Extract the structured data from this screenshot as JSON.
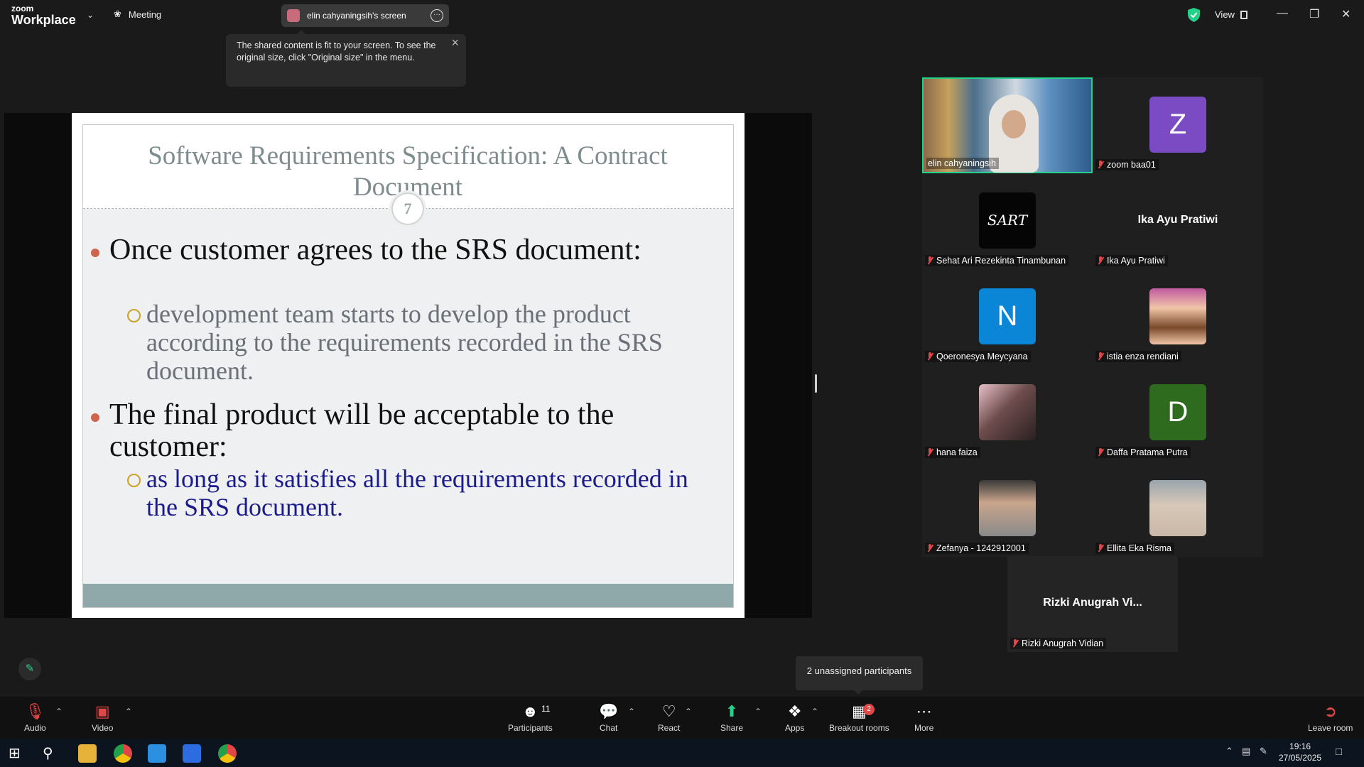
{
  "app": {
    "brand_top": "zoom",
    "brand_bottom": "Workplace",
    "meeting_label": "Meeting"
  },
  "share_pill": {
    "label": "elin cahyaningsih's screen"
  },
  "header": {
    "view_label": "View"
  },
  "tooltip": {
    "text": "The shared content is fit to your screen. To see the original size, click \"Original size\" in the menu."
  },
  "slide": {
    "title": "Software Requirements Specification: A Contract Document",
    "page_number": "7",
    "bullets": [
      {
        "text": "Once customer agrees to the SRS document:",
        "sub": "development team starts to develop the product according to the requirements recorded in the SRS document."
      },
      {
        "text": "The final product will be acceptable to the customer:",
        "sub": "as long as it satisfies all the requirements recorded in the SRS document."
      }
    ]
  },
  "participants": [
    {
      "name": "elin cahyaningsih",
      "type": "video",
      "active": true,
      "muted": false
    },
    {
      "name": "zoom baa01",
      "type": "initial",
      "initial": "Z",
      "color": "#7b4bc4",
      "muted": true
    },
    {
      "name": "Sehat Ari Rezekinta Tinambunan",
      "type": "logo",
      "initial": "SART",
      "color": "#050505",
      "muted": true
    },
    {
      "name": "Ika Ayu Pratiwi",
      "type": "text",
      "display": "Ika Ayu Pratiwi",
      "muted": true
    },
    {
      "name": "Qoeronesya Meycyana",
      "type": "initial",
      "initial": "N",
      "color": "#0b86d6",
      "muted": true
    },
    {
      "name": "istia enza rendiani",
      "type": "photo",
      "color": "#f1c5a8",
      "muted": true
    },
    {
      "name": "hana faiza",
      "type": "photo",
      "color": "#6d4c4c",
      "muted": true
    },
    {
      "name": "Daffa Pratama Putra",
      "type": "initial",
      "initial": "D",
      "color": "#2e6b1f",
      "muted": true
    },
    {
      "name": "Zefanya - 1242912001",
      "type": "photo",
      "color": "#8a8a8a",
      "muted": true
    },
    {
      "name": "Ellita Eka Risma",
      "type": "photo",
      "color": "#c9b8a8",
      "muted": true
    },
    {
      "name": "Rizki Anugrah Vidian",
      "type": "text",
      "display": "Rizki Anugrah Vi...",
      "muted": true
    }
  ],
  "unassigned": "2 unassigned participants",
  "toolbar": {
    "audio": "Audio",
    "video": "Video",
    "participants": "Participants",
    "participants_count": "11",
    "chat": "Chat",
    "react": "React",
    "share": "Share",
    "apps": "Apps",
    "breakout": "Breakout rooms",
    "breakout_badge": "2",
    "more": "More",
    "leave": "Leave room"
  },
  "taskbar": {
    "time": "19:16",
    "date": "27/05/2025"
  },
  "colors": {
    "accent": "#23d18b",
    "muted": "#e04848",
    "bullet": "#d0634c",
    "sub_bullet": "#c9a227",
    "slide_footer": "#8fa9aa"
  }
}
